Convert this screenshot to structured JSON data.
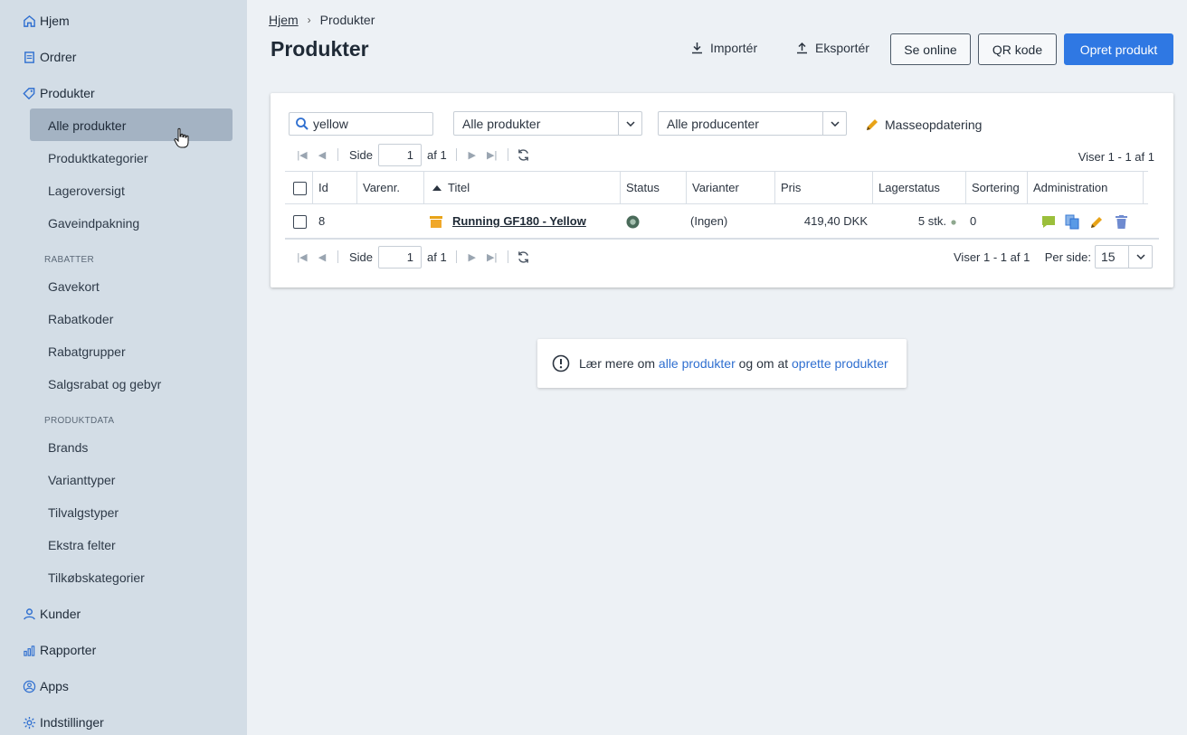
{
  "sidebar": {
    "top_items": [
      {
        "label": "Hjem",
        "icon": "home-icon"
      },
      {
        "label": "Ordrer",
        "icon": "receipt-icon"
      },
      {
        "label": "Produkter",
        "icon": "tag-icon"
      }
    ],
    "produkter_sub": [
      "Alle produkter",
      "Produktkategorier",
      "Lageroversigt",
      "Gaveindpakning"
    ],
    "group_rabatter": "RABATTER",
    "rabatter_sub": [
      "Gavekort",
      "Rabatkoder",
      "Rabatgrupper",
      "Salgsrabat og gebyr"
    ],
    "group_produktdata": "PRODUKTDATA",
    "produktdata_sub": [
      "Brands",
      "Varianttyper",
      "Tilvalgstyper",
      "Ekstra felter",
      "Tilkøbskategorier"
    ],
    "bottom_items": [
      {
        "label": "Kunder",
        "icon": "user-icon"
      },
      {
        "label": "Rapporter",
        "icon": "chart-icon"
      },
      {
        "label": "Apps",
        "icon": "apps-icon"
      },
      {
        "label": "Indstillinger",
        "icon": "gear-icon"
      }
    ]
  },
  "breadcrumb": {
    "home": "Hjem",
    "separator": "›",
    "current": "Produkter"
  },
  "header": {
    "title": "Produkter",
    "import_label": "Importér",
    "export_label": "Eksportér",
    "online_label": "Se online",
    "qr_label": "QR kode",
    "create_label": "Opret produkt"
  },
  "filters": {
    "search_value": "yellow",
    "product_filter": "Alle produkter",
    "manufacturer_filter": "Alle producenter",
    "mass_update_label": "Masseopdatering"
  },
  "pager": {
    "page_label": "Side",
    "page_value": "1",
    "of_label": "af 1",
    "showing": "Viser 1 - 1 af 1",
    "per_page_label": "Per side:",
    "per_page_value": "15"
  },
  "table": {
    "columns": [
      "Id",
      "Varenr.",
      "Titel",
      "Status",
      "Varianter",
      "Pris",
      "Lagerstatus",
      "Sortering",
      "Administration"
    ],
    "rows": [
      {
        "id": "8",
        "sku": "",
        "title": "Running GF180 - Yellow",
        "variants": "(Ingen)",
        "price": "419,40 DKK",
        "stock": "5 stk.",
        "sort": "0"
      }
    ]
  },
  "info": {
    "prefix": "Lær mere om",
    "link1": "alle produkter",
    "middle": "og om at",
    "link2": "oprette produkter"
  },
  "colors": {
    "sidebar_bg": "#d3dde6",
    "active_item_bg": "#a4b3c3",
    "primary": "#2f78e3",
    "link": "#2f6fd0",
    "status_active": "#4a6b5a"
  }
}
